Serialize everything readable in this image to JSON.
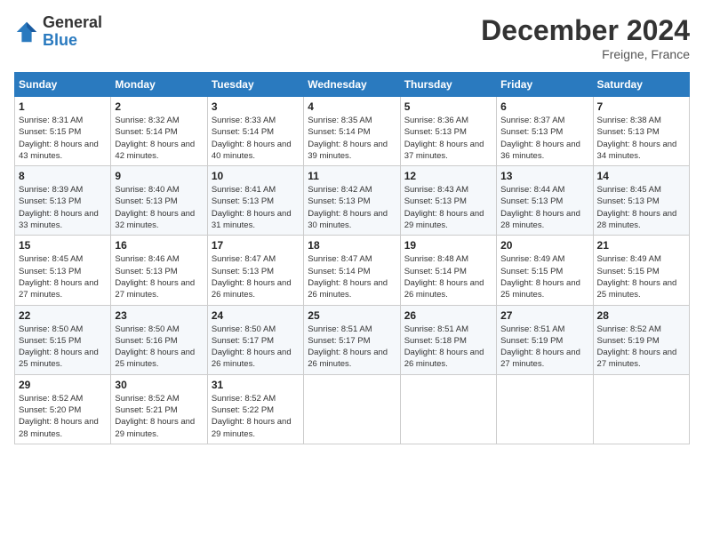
{
  "header": {
    "logo_general": "General",
    "logo_blue": "Blue",
    "month_title": "December 2024",
    "subtitle": "Freigne, France"
  },
  "days_of_week": [
    "Sunday",
    "Monday",
    "Tuesday",
    "Wednesday",
    "Thursday",
    "Friday",
    "Saturday"
  ],
  "weeks": [
    [
      {
        "day": "1",
        "sunrise": "8:31 AM",
        "sunset": "5:15 PM",
        "daylight": "8 hours and 43 minutes."
      },
      {
        "day": "2",
        "sunrise": "8:32 AM",
        "sunset": "5:14 PM",
        "daylight": "8 hours and 42 minutes."
      },
      {
        "day": "3",
        "sunrise": "8:33 AM",
        "sunset": "5:14 PM",
        "daylight": "8 hours and 40 minutes."
      },
      {
        "day": "4",
        "sunrise": "8:35 AM",
        "sunset": "5:14 PM",
        "daylight": "8 hours and 39 minutes."
      },
      {
        "day": "5",
        "sunrise": "8:36 AM",
        "sunset": "5:13 PM",
        "daylight": "8 hours and 37 minutes."
      },
      {
        "day": "6",
        "sunrise": "8:37 AM",
        "sunset": "5:13 PM",
        "daylight": "8 hours and 36 minutes."
      },
      {
        "day": "7",
        "sunrise": "8:38 AM",
        "sunset": "5:13 PM",
        "daylight": "8 hours and 34 minutes."
      }
    ],
    [
      {
        "day": "8",
        "sunrise": "8:39 AM",
        "sunset": "5:13 PM",
        "daylight": "8 hours and 33 minutes."
      },
      {
        "day": "9",
        "sunrise": "8:40 AM",
        "sunset": "5:13 PM",
        "daylight": "8 hours and 32 minutes."
      },
      {
        "day": "10",
        "sunrise": "8:41 AM",
        "sunset": "5:13 PM",
        "daylight": "8 hours and 31 minutes."
      },
      {
        "day": "11",
        "sunrise": "8:42 AM",
        "sunset": "5:13 PM",
        "daylight": "8 hours and 30 minutes."
      },
      {
        "day": "12",
        "sunrise": "8:43 AM",
        "sunset": "5:13 PM",
        "daylight": "8 hours and 29 minutes."
      },
      {
        "day": "13",
        "sunrise": "8:44 AM",
        "sunset": "5:13 PM",
        "daylight": "8 hours and 28 minutes."
      },
      {
        "day": "14",
        "sunrise": "8:45 AM",
        "sunset": "5:13 PM",
        "daylight": "8 hours and 28 minutes."
      }
    ],
    [
      {
        "day": "15",
        "sunrise": "8:45 AM",
        "sunset": "5:13 PM",
        "daylight": "8 hours and 27 minutes."
      },
      {
        "day": "16",
        "sunrise": "8:46 AM",
        "sunset": "5:13 PM",
        "daylight": "8 hours and 27 minutes."
      },
      {
        "day": "17",
        "sunrise": "8:47 AM",
        "sunset": "5:13 PM",
        "daylight": "8 hours and 26 minutes."
      },
      {
        "day": "18",
        "sunrise": "8:47 AM",
        "sunset": "5:14 PM",
        "daylight": "8 hours and 26 minutes."
      },
      {
        "day": "19",
        "sunrise": "8:48 AM",
        "sunset": "5:14 PM",
        "daylight": "8 hours and 26 minutes."
      },
      {
        "day": "20",
        "sunrise": "8:49 AM",
        "sunset": "5:15 PM",
        "daylight": "8 hours and 25 minutes."
      },
      {
        "day": "21",
        "sunrise": "8:49 AM",
        "sunset": "5:15 PM",
        "daylight": "8 hours and 25 minutes."
      }
    ],
    [
      {
        "day": "22",
        "sunrise": "8:50 AM",
        "sunset": "5:15 PM",
        "daylight": "8 hours and 25 minutes."
      },
      {
        "day": "23",
        "sunrise": "8:50 AM",
        "sunset": "5:16 PM",
        "daylight": "8 hours and 25 minutes."
      },
      {
        "day": "24",
        "sunrise": "8:50 AM",
        "sunset": "5:17 PM",
        "daylight": "8 hours and 26 minutes."
      },
      {
        "day": "25",
        "sunrise": "8:51 AM",
        "sunset": "5:17 PM",
        "daylight": "8 hours and 26 minutes."
      },
      {
        "day": "26",
        "sunrise": "8:51 AM",
        "sunset": "5:18 PM",
        "daylight": "8 hours and 26 minutes."
      },
      {
        "day": "27",
        "sunrise": "8:51 AM",
        "sunset": "5:19 PM",
        "daylight": "8 hours and 27 minutes."
      },
      {
        "day": "28",
        "sunrise": "8:52 AM",
        "sunset": "5:19 PM",
        "daylight": "8 hours and 27 minutes."
      }
    ],
    [
      {
        "day": "29",
        "sunrise": "8:52 AM",
        "sunset": "5:20 PM",
        "daylight": "8 hours and 28 minutes."
      },
      {
        "day": "30",
        "sunrise": "8:52 AM",
        "sunset": "5:21 PM",
        "daylight": "8 hours and 29 minutes."
      },
      {
        "day": "31",
        "sunrise": "8:52 AM",
        "sunset": "5:22 PM",
        "daylight": "8 hours and 29 minutes."
      },
      null,
      null,
      null,
      null
    ]
  ]
}
